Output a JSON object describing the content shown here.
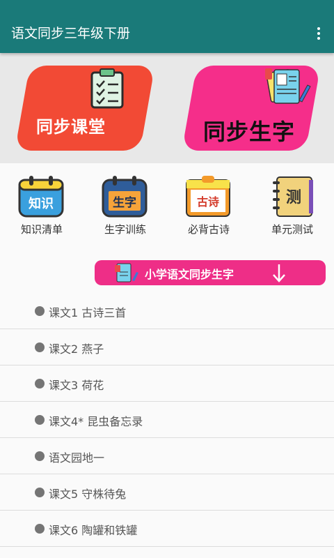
{
  "appbar": {
    "title": "语文同步三年级下册",
    "menu_icon": "more-vert-icon"
  },
  "banner": {
    "left": {
      "label": "同步课堂",
      "icon": "clipboard-checklist-icon",
      "color": "#f24a35"
    },
    "right": {
      "label": "同步生字",
      "icon": "notes-pen-icon",
      "color": "#f52e8a"
    }
  },
  "quick_actions": [
    {
      "label": "知识清单",
      "icon_text": "知识",
      "icon": "knowledge-calendar-icon"
    },
    {
      "label": "生字训练",
      "icon_text": "生字",
      "icon": "characters-calendar-icon"
    },
    {
      "label": "必背古诗",
      "icon_text": "古诗",
      "icon": "poem-calendar-icon"
    },
    {
      "label": "单元测试",
      "icon_text": "测",
      "icon": "test-notebook-icon"
    }
  ],
  "section": {
    "title": "小学语文同步生字",
    "icon": "arrow-down-icon"
  },
  "lessons": [
    "课文1 古诗三首",
    "课文2 燕子",
    "课文3 荷花",
    "课文4* 昆虫备忘录",
    "语文园地一",
    "课文5 守株待兔",
    "课文6 陶罐和铁罐"
  ],
  "colors": {
    "appbar": "#1a7a79",
    "accent_pink": "#ee2e87",
    "accent_red": "#f24a35"
  }
}
